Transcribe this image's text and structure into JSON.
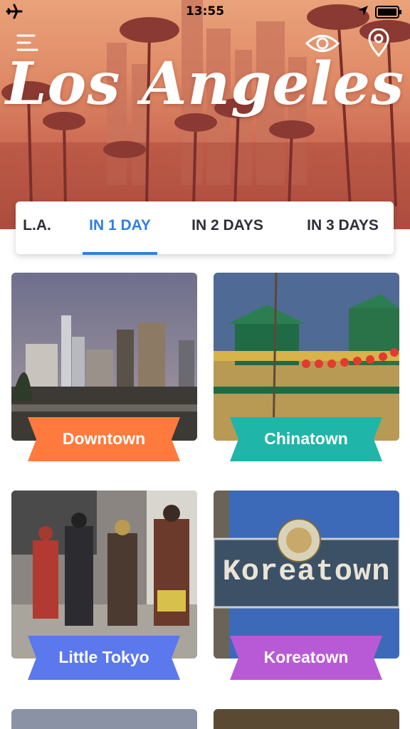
{
  "status": {
    "time": "13:55"
  },
  "header": {
    "title": "Los Angeles"
  },
  "tabs": [
    {
      "label": "L.A."
    },
    {
      "label": "IN 1 DAY",
      "active": true
    },
    {
      "label": "IN 2 DAYS"
    },
    {
      "label": "IN 3 DAYS"
    }
  ],
  "neighborhoods": [
    {
      "label": "Downtown",
      "color": "#ff7a3c"
    },
    {
      "label": "Chinatown",
      "color": "#1fb5a8"
    },
    {
      "label": "Little Tokyo",
      "color": "#5b78ec"
    },
    {
      "label": "Koreatown",
      "color": "#b85ad6"
    }
  ],
  "koreatown_sign": {
    "text": "Koreatown"
  },
  "colors": {
    "accent": "#2f7fe0"
  }
}
